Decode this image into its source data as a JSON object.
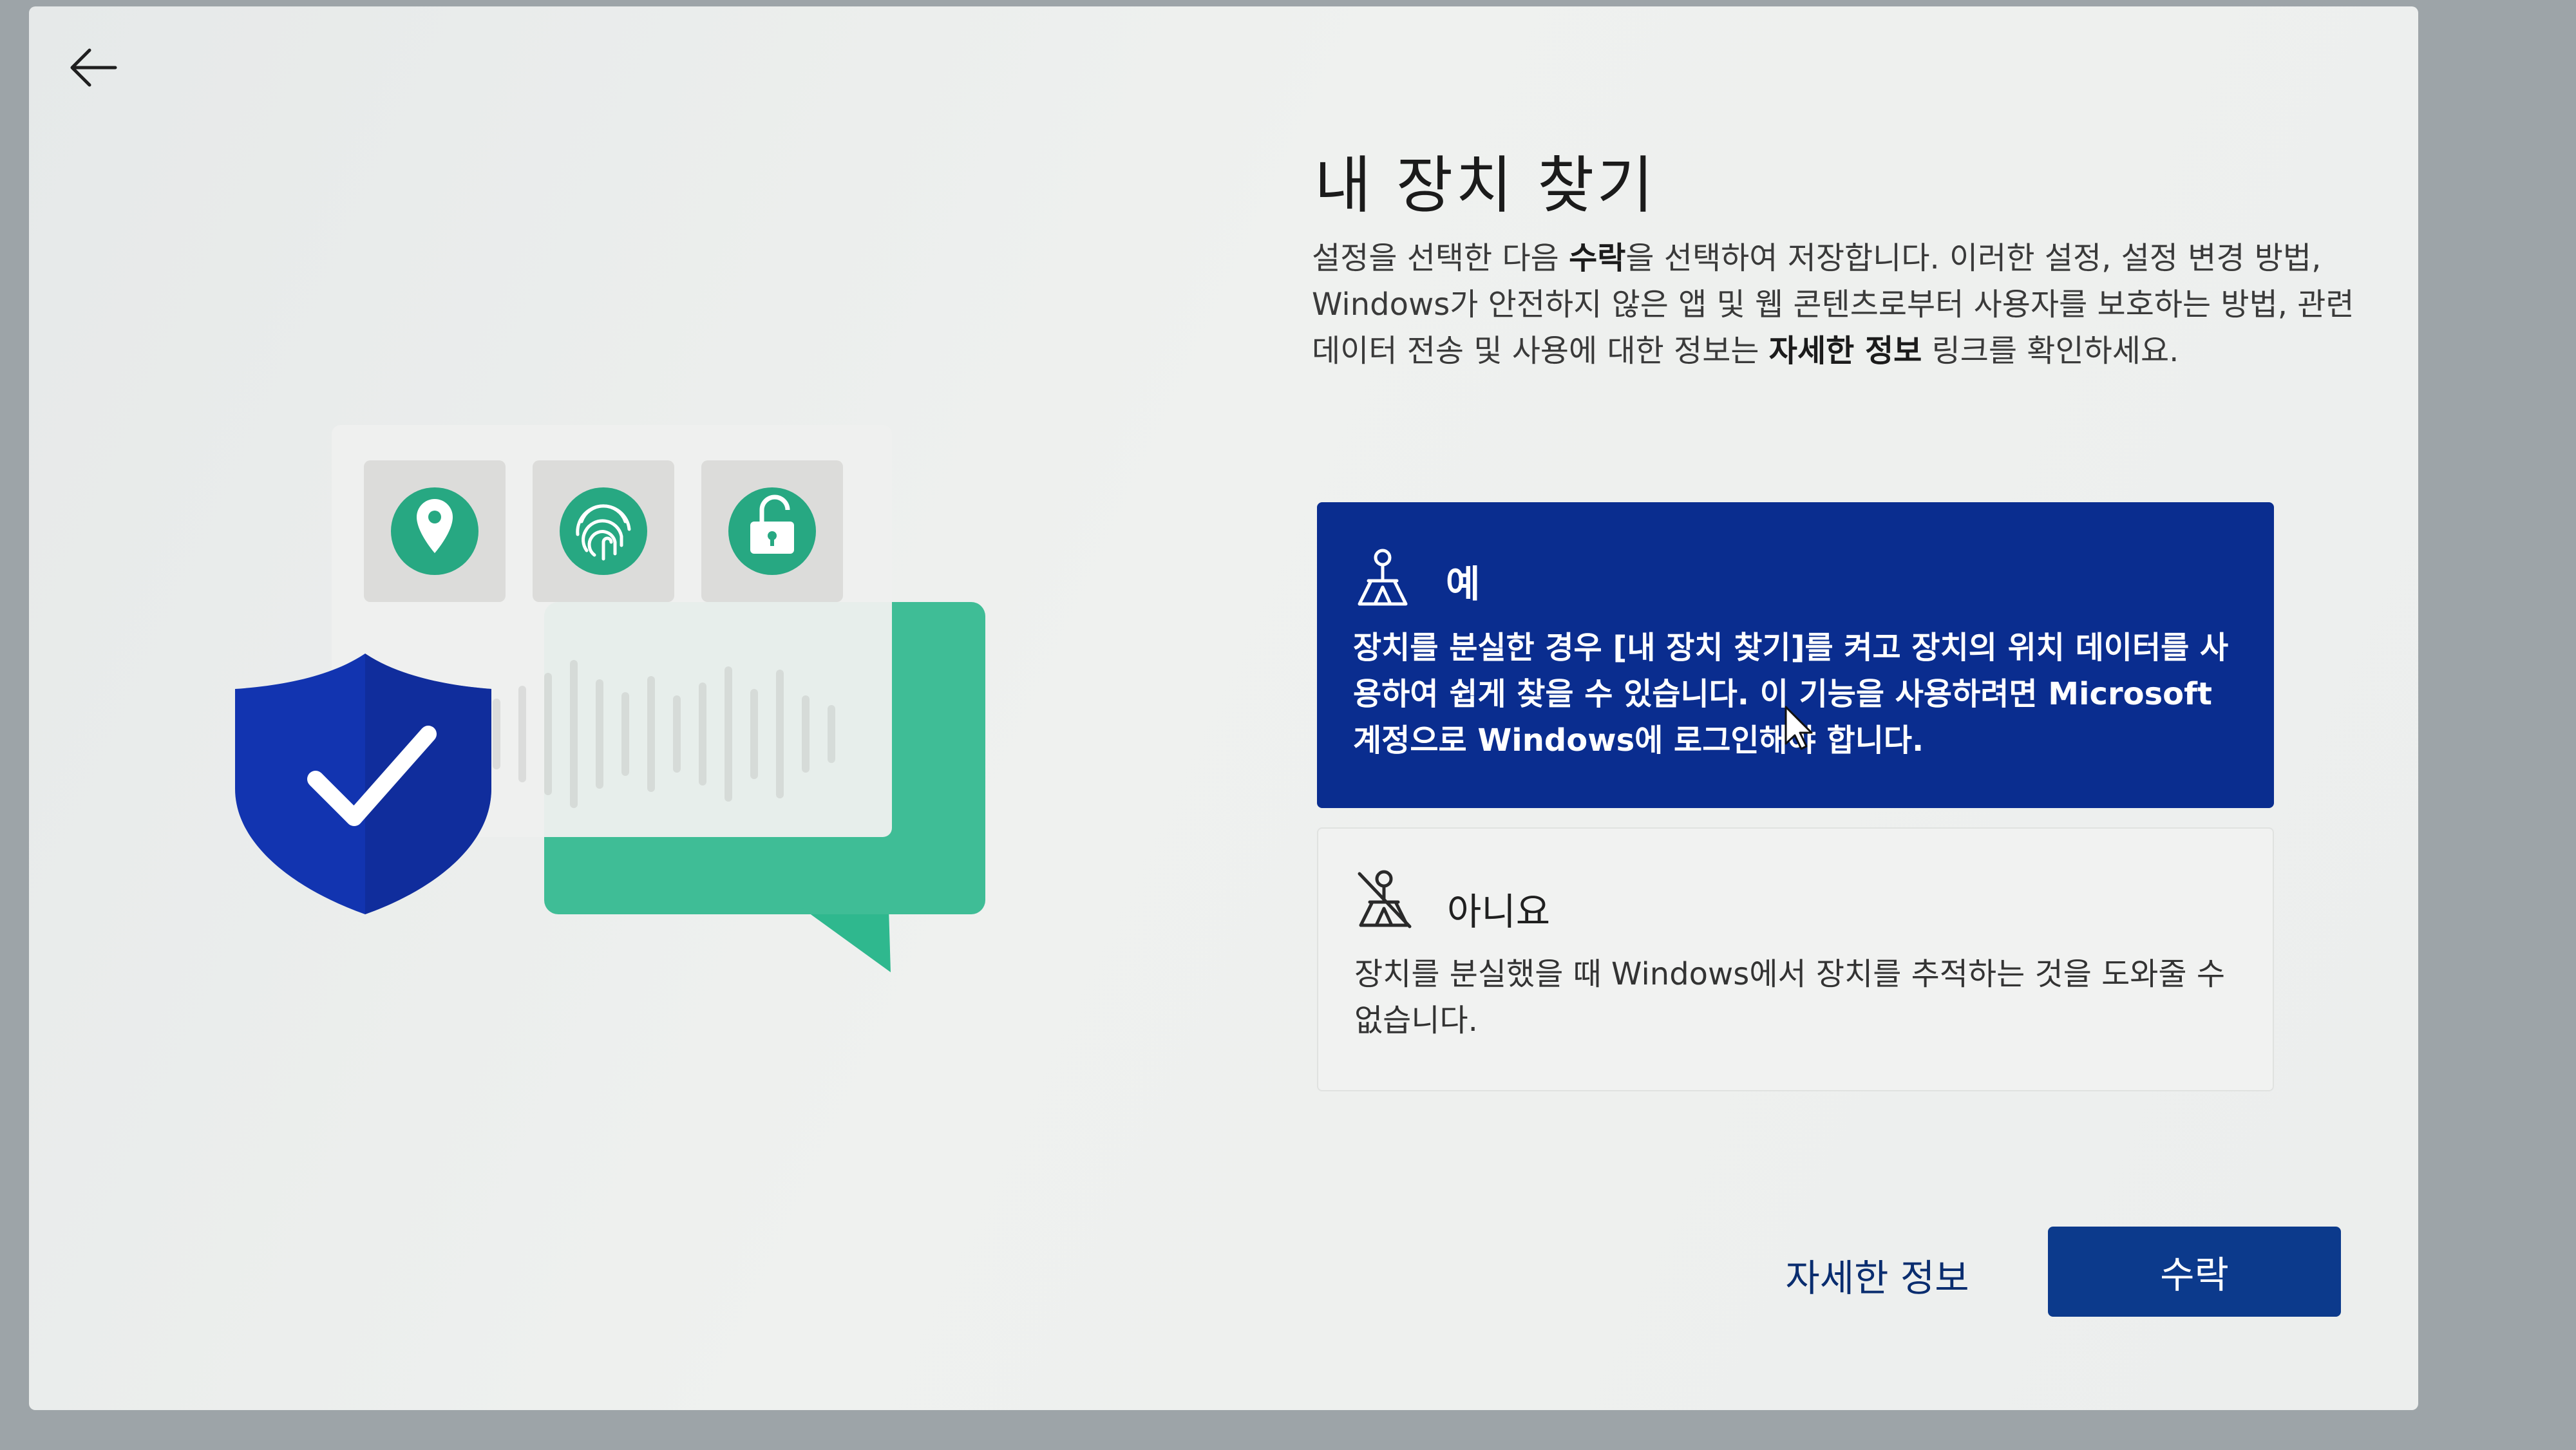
{
  "page": {
    "title": "내 장치 찾기",
    "description": {
      "part1": "설정을 선택한 다음 ",
      "accept_word": "수락",
      "part2": "을 선택하여 저장합니다. 이러한 설정, 설정 변경 방법, Windows가 안전하지 않은 앱 및 웹 콘텐츠로부터 사용자를 보호하는 방법, 관련 데이터 전송 및 사용에 대한 정보는 ",
      "more_info_word": "자세한 정보",
      "part3": " 링크를 확인하세요."
    }
  },
  "options": [
    {
      "label": "예",
      "description": "장치를 분실한 경우 [내 장치 찾기]를 켜고 장치의 위치 데이터를 사용하여 쉽게 찾을 수 있습니다. 이 기능을 사용하려면 Microsoft 계정으로 Windows에 로그인해야 합니다.",
      "selected": true,
      "icon": "person-location-icon"
    },
    {
      "label": "아니요",
      "description": "장치를 분실했을 때 Windows에서 장치를 추적하는 것을 도와줄 수 없습니다.",
      "selected": false,
      "icon": "person-location-off-icon"
    }
  ],
  "footer": {
    "more_info_label": "자세한 정보",
    "accept_label": "수락"
  },
  "colors": {
    "selected_option": "#0a2d8f",
    "accept_button": "#0c3a8c",
    "illustration_green": "#2fb88e",
    "shield_blue": "#1234b0"
  },
  "icons": [
    "back-arrow-icon",
    "location-pin-icon",
    "fingerprint-icon",
    "unlock-icon",
    "shield-check-icon",
    "chat-bubble-icon",
    "mouse-cursor-icon"
  ]
}
